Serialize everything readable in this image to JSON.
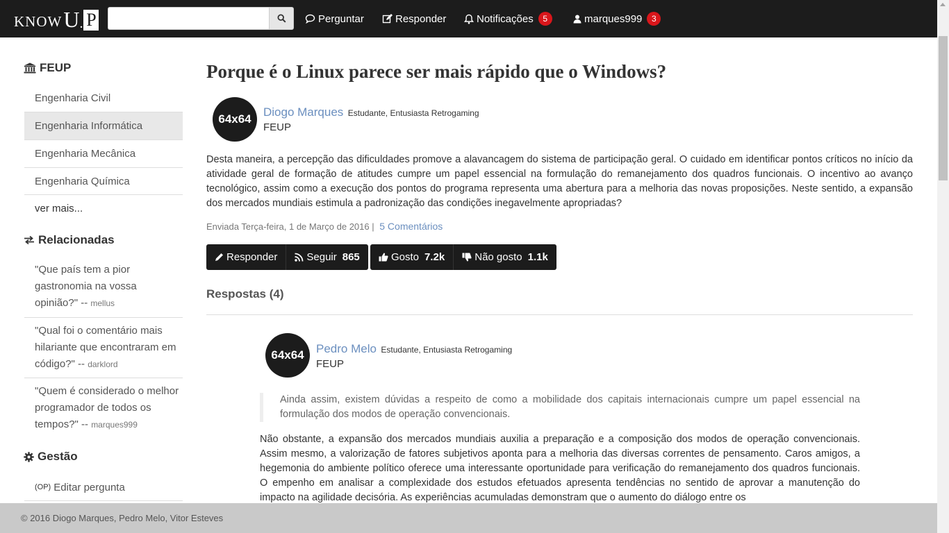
{
  "brand": {
    "know": "KNOW",
    "u": "U",
    "dot": ".",
    "p": "P"
  },
  "search": {
    "placeholder": "",
    "value": ""
  },
  "nav": {
    "ask": "Perguntar",
    "answer": "Responder",
    "notifications": "Notificações",
    "notifications_count": "5",
    "user": "marques999",
    "user_count": "3"
  },
  "sidebar": {
    "faculty_title": "FEUP",
    "courses": [
      "Engenharia Civil",
      "Engenharia Informática",
      "Engenharia Mecânica",
      "Engenharia Química"
    ],
    "more": "ver mais...",
    "related_title": "Relacionadas",
    "related": [
      {
        "q1": "\"Que país tem a pior",
        "q2": "gastronomia na vossa",
        "q3": "opinião?\" --",
        "who": "mellus"
      },
      {
        "q1": "\"Qual foi o comentário mais",
        "q2": "hilariante que encontraram em",
        "q3": "código?\" --",
        "who": "darklord"
      },
      {
        "q1": "\"Quem é considerado o melhor",
        "q2": "programador de todos os",
        "q3": "tempos?\" --",
        "who": "marques999"
      }
    ],
    "manage_title": "Gestão",
    "manage_tag": "(OP)",
    "manage_edit": "Editar pergunta"
  },
  "question": {
    "title": "Porque é o Linux parece ser mais rápido que o Windows?",
    "avatar": "64x64",
    "author": "Diogo Marques",
    "author_desc": "Estudante, Entusiasta Retrogaming",
    "org": "FEUP",
    "body": "Desta maneira, a percepção das dificuldades promove a alavancagem do sistema de participação geral. O cuidado em identificar pontos críticos no início da atividade geral de formação de atitudes cumpre um papel essencial na formulação do remanejamento dos quadros funcionais. O incentivo ao avanço tecnológico, assim como a execução dos pontos do programa representa uma abertura para a melhoria das novas proposições. Neste sentido, a expansão dos mercados mundiais estimula a padronização das condições inegavelmente apropriadas?",
    "date": "Enviada Terça-feira, 1 de Março de 2016 |",
    "comments": "5 Comentários",
    "reply": "Responder",
    "follow": "Seguir",
    "follow_count": "865",
    "like": "Gosto",
    "like_count": "7.2k",
    "dislike": "Não gosto",
    "dislike_count": "1.1k"
  },
  "answers": {
    "heading": "Respostas (4)",
    "first": {
      "avatar": "64x64",
      "author": "Pedro Melo",
      "author_desc": "Estudante, Entusiasta Retrogaming",
      "org": "FEUP",
      "quote": "Ainda assim, existem dúvidas a respeito de como a mobilidade dos capitais internacionais cumpre um papel essencial na formulação dos modos de operação convencionais.",
      "body": "Não obstante, a expansão dos mercados mundiais auxilia a preparação e a composição dos modos de operação convencionais. Assim mesmo, a valorização de fatores subjetivos aponta para a melhoria das diversas correntes de pensamento. Caros amigos, a hegemonia do ambiente político oferece uma interessante oportunidade para verificação do remanejamento dos quadros funcionais. O empenho em analisar a complexidade dos estudos efetuados apresenta tendências no sentido de aprovar a manutenção do impacto na agilidade decisória. As experiências acumuladas demonstram que o aumento do diálogo entre os"
    }
  },
  "footer": {
    "text": "© 2016 Diogo Marques, Pedro Melo, Vitor Esteves"
  },
  "colors": {
    "navbar": "#1c1c1c",
    "link": "#6b8fbf",
    "badge": "#d9161b",
    "footer": "#c9c9c9"
  }
}
